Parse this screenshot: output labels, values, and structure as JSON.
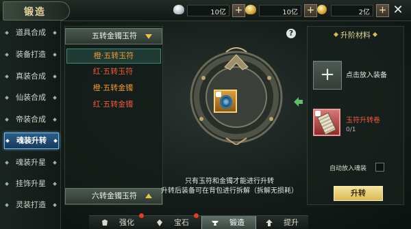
{
  "window": {
    "title": "锻造"
  },
  "resources": [
    {
      "icon": "silver-ingot-icon",
      "amount": "10亿"
    },
    {
      "icon": "gold-ingot-icon",
      "amount": "10亿"
    },
    {
      "icon": "coin-icon",
      "amount": "2亿"
    }
  ],
  "sidebar": {
    "items": [
      {
        "label": "道具合成"
      },
      {
        "label": "装备打造"
      },
      {
        "label": "真装合成"
      },
      {
        "label": "仙装合成"
      },
      {
        "label": "帝装合成"
      },
      {
        "label": "魂装升转"
      },
      {
        "label": "魂装升星"
      },
      {
        "label": "挂饰升星"
      },
      {
        "label": "灵装打造"
      }
    ],
    "active": "魂装升转"
  },
  "list": {
    "top_dropdown": "五转金镯玉符",
    "options": [
      {
        "label": "橙·五转玉符",
        "tone": "orange",
        "selected": true
      },
      {
        "label": "红·五转玉符",
        "tone": "red",
        "selected": false
      },
      {
        "label": "橙·五转金镯",
        "tone": "orange",
        "selected": false
      },
      {
        "label": "红·五转金镯",
        "tone": "red",
        "selected": false
      }
    ],
    "bottom_dropdown": "六转金镯玉符"
  },
  "forge": {
    "info_lines": [
      "只有玉符和金镯才能进行升转",
      "升转后装备可在背包进行拆解（拆解无损耗）"
    ],
    "help_symbol": "?"
  },
  "materials": {
    "heading": "升阶材料",
    "add_text": "点击放入装备",
    "material_name": "玉符升转卷",
    "material_count": "0/1",
    "auto_label": "自动放入魂装",
    "upgrade_button": "升转"
  },
  "bottom_tabs": [
    {
      "label": "强化",
      "icon": "armor-icon",
      "active": false,
      "badge": true
    },
    {
      "label": "宝石",
      "icon": "gem-icon",
      "active": false,
      "badge": true
    },
    {
      "label": "锻造",
      "icon": "anvil-icon",
      "active": true,
      "badge": false
    },
    {
      "label": "提升",
      "icon": "upgrade-icon",
      "active": false,
      "badge": false
    }
  ],
  "colors": {
    "active_tab": "#2c5e88",
    "orange_option": "#f39a3a",
    "red_option": "#ee5a3c",
    "upgrade_button": "#f4e39a",
    "badge": "#e23c2a"
  }
}
